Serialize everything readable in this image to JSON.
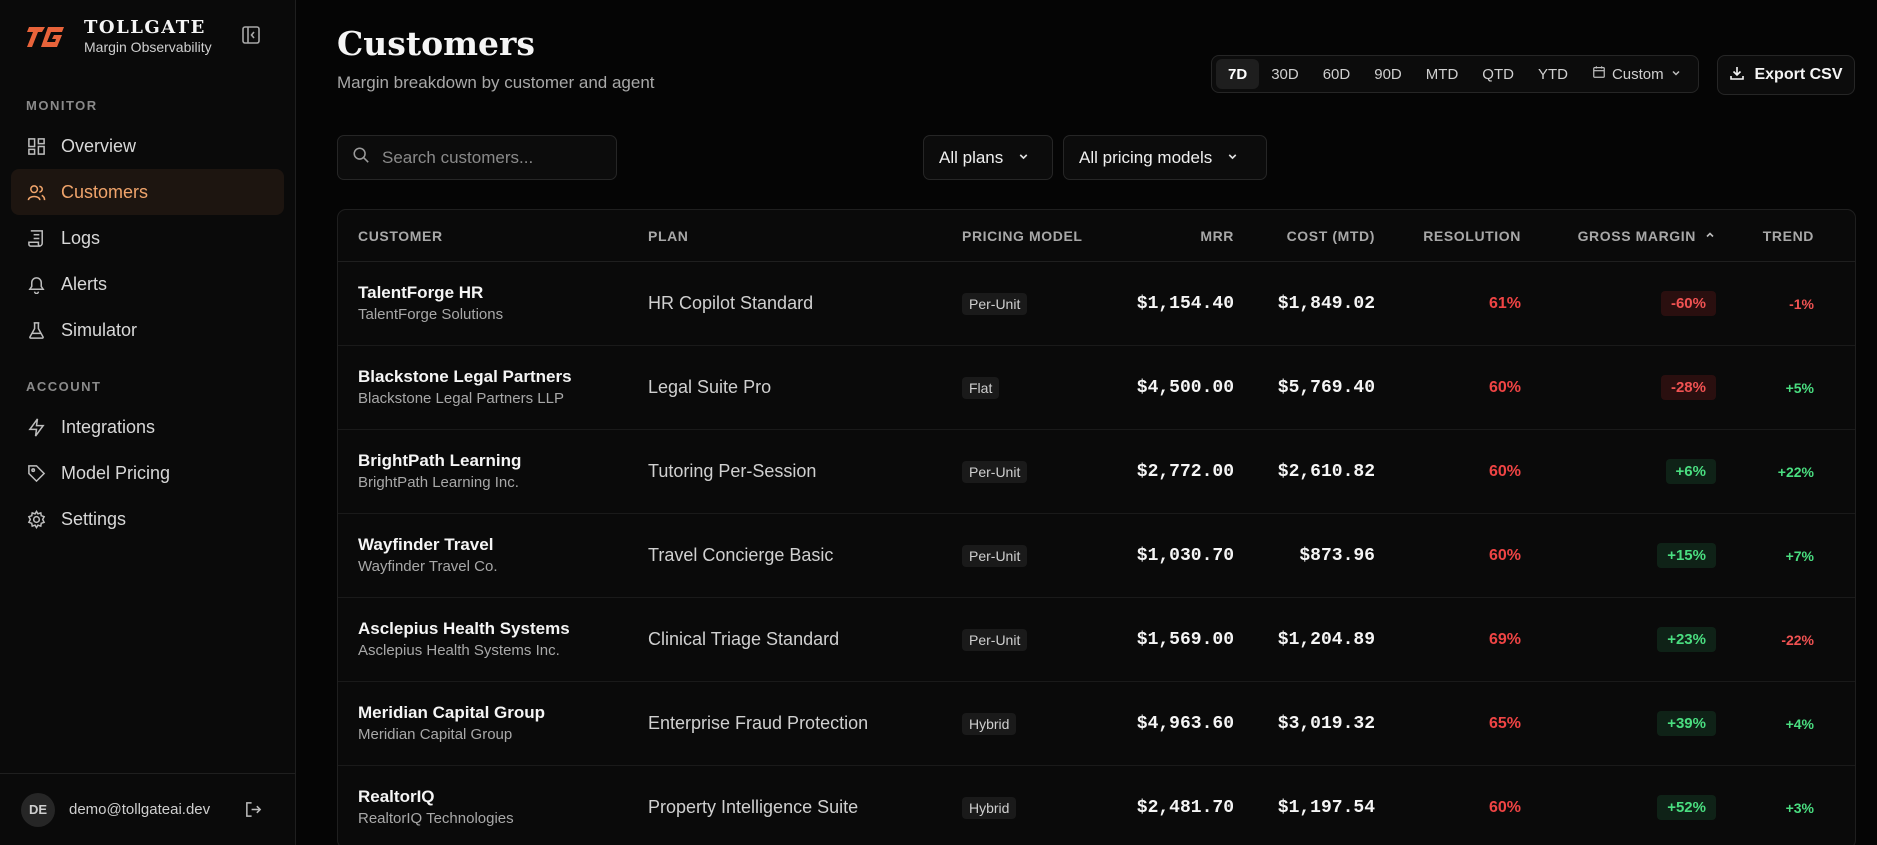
{
  "brand": {
    "name": "TOLLGATE",
    "subtitle": "Margin Observability"
  },
  "sidebar": {
    "monitor_label": "MONITOR",
    "monitor_items": [
      {
        "label": "Overview",
        "icon": "grid-icon"
      },
      {
        "label": "Customers",
        "icon": "users-icon",
        "active": true
      },
      {
        "label": "Logs",
        "icon": "scroll-icon"
      },
      {
        "label": "Alerts",
        "icon": "bell-icon"
      },
      {
        "label": "Simulator",
        "icon": "flask-icon"
      }
    ],
    "account_label": "ACCOUNT",
    "account_items": [
      {
        "label": "Integrations",
        "icon": "bolt-icon"
      },
      {
        "label": "Model Pricing",
        "icon": "tag-icon"
      },
      {
        "label": "Settings",
        "icon": "gear-icon"
      }
    ],
    "user": {
      "initials": "DE",
      "email": "demo@tollgateai.dev"
    }
  },
  "header": {
    "title": "Customers",
    "subtitle": "Margin breakdown by customer and agent",
    "ranges": [
      "7D",
      "30D",
      "60D",
      "90D",
      "MTD",
      "QTD",
      "YTD"
    ],
    "active_range": "7D",
    "custom_label": "Custom",
    "export_label": "Export CSV"
  },
  "filters": {
    "search_placeholder": "Search customers...",
    "plan_select": "All plans",
    "pricing_select": "All pricing models"
  },
  "table": {
    "columns": {
      "customer": "CUSTOMER",
      "plan": "PLAN",
      "pricing_model": "PRICING MODEL",
      "mrr": "MRR",
      "cost": "COST (MTD)",
      "resolution": "RESOLUTION",
      "gross_margin": "GROSS MARGIN",
      "trend": "TREND"
    },
    "rows": [
      {
        "name": "TalentForge HR",
        "company": "TalentForge Solutions",
        "plan": "HR Copilot Standard",
        "model": "Per-Unit",
        "mrr": "$1,154.40",
        "cost": "$1,849.02",
        "resolution": "61%",
        "margin": "-60%",
        "trend": "-1%"
      },
      {
        "name": "Blackstone Legal Partners",
        "company": "Blackstone Legal Partners LLP",
        "plan": "Legal Suite Pro",
        "model": "Flat",
        "mrr": "$4,500.00",
        "cost": "$5,769.40",
        "resolution": "60%",
        "margin": "-28%",
        "trend": "+5%"
      },
      {
        "name": "BrightPath Learning",
        "company": "BrightPath Learning Inc.",
        "plan": "Tutoring Per-Session",
        "model": "Per-Unit",
        "mrr": "$2,772.00",
        "cost": "$2,610.82",
        "resolution": "60%",
        "margin": "+6%",
        "trend": "+22%"
      },
      {
        "name": "Wayfinder Travel",
        "company": "Wayfinder Travel Co.",
        "plan": "Travel Concierge Basic",
        "model": "Per-Unit",
        "mrr": "$1,030.70",
        "cost": "$873.96",
        "resolution": "60%",
        "margin": "+15%",
        "trend": "+7%"
      },
      {
        "name": "Asclepius Health Systems",
        "company": "Asclepius Health Systems Inc.",
        "plan": "Clinical Triage Standard",
        "model": "Per-Unit",
        "mrr": "$1,569.00",
        "cost": "$1,204.89",
        "resolution": "69%",
        "margin": "+23%",
        "trend": "-22%"
      },
      {
        "name": "Meridian Capital Group",
        "company": "Meridian Capital Group",
        "plan": "Enterprise Fraud Protection",
        "model": "Hybrid",
        "mrr": "$4,963.60",
        "cost": "$3,019.32",
        "resolution": "65%",
        "margin": "+39%",
        "trend": "+4%"
      },
      {
        "name": "RealtorIQ",
        "company": "RealtorIQ Technologies",
        "plan": "Property Intelligence Suite",
        "model": "Hybrid",
        "mrr": "$2,481.70",
        "cost": "$1,197.54",
        "resolution": "60%",
        "margin": "+52%",
        "trend": "+3%"
      }
    ]
  },
  "colors": {
    "accent": "#f0a46b",
    "negative": "#f05252",
    "positive": "#4ade80"
  }
}
